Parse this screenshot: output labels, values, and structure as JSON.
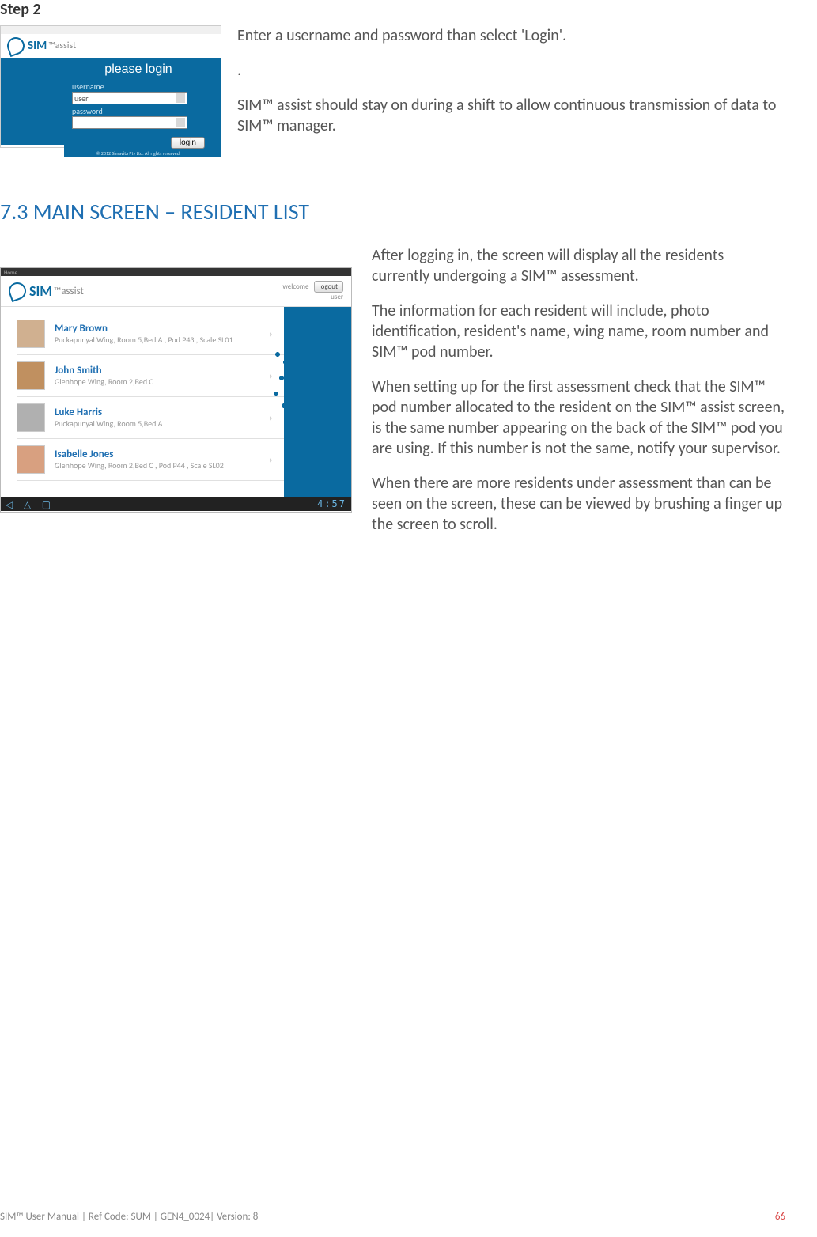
{
  "step2": {
    "heading": "Step 2",
    "login_shot": {
      "logo_brand": "SIM",
      "logo_sub": "™assist",
      "please_login": "please login",
      "username_label": "username",
      "username_value": "user",
      "password_label": "password",
      "login_button": "login",
      "copyright": "© 2012 Simavita Pty Ltd. All rights reserved."
    },
    "text": {
      "p1": "Enter a username and password than select 'Login'.",
      "p2": ".",
      "p3": "SIM™ assist should stay on during a shift to allow continuous transmission of data to SIM™ manager."
    }
  },
  "section73": {
    "heading": "7.3 MAIN SCREEN – RESIDENT LIST",
    "resident_shot": {
      "status_left": "Home",
      "logo_brand": "SIM",
      "logo_sub": "™assist",
      "welcome_label": "welcome",
      "logout_btn": "logout",
      "welcome_user": "user",
      "residents": [
        {
          "name": "Mary Brown",
          "detail": "Puckapunyal Wing, Room 5,Bed A , Pod P43 , Scale SL01"
        },
        {
          "name": "John Smith",
          "detail": "Glenhope Wing, Room 2,Bed C"
        },
        {
          "name": "Luke Harris",
          "detail": "Puckapunyal Wing, Room 5,Bed A"
        },
        {
          "name": "Isabelle Jones",
          "detail": "Glenhope Wing, Room 2,Bed C , Pod P44 , Scale SL02"
        }
      ],
      "nav_back": "◁",
      "nav_home": "△",
      "nav_recent": "▢",
      "clock": "4:57"
    },
    "text": {
      "p1": "After logging in, the screen will display all the residents currently undergoing a SIM™ assessment.",
      "p2": "The information for each resident will include, photo identification, resident's name, wing name, room number and SIM™ pod number.",
      "p3": "When setting up for the first assessment check that the SIM™ pod number allocated to the resident on the SIM™ assist screen, is the same number appearing on the back of the SIM™ pod you are using. If this number is not the same, notify your supervisor.",
      "p4": "When there are more residents under assessment than can be seen on the screen, these can be viewed by brushing a finger up the screen to scroll."
    }
  },
  "footer": {
    "left": "SIM™ User Manual | Ref Code: SUM | GEN4_0024| Version: 8",
    "page": "66"
  }
}
